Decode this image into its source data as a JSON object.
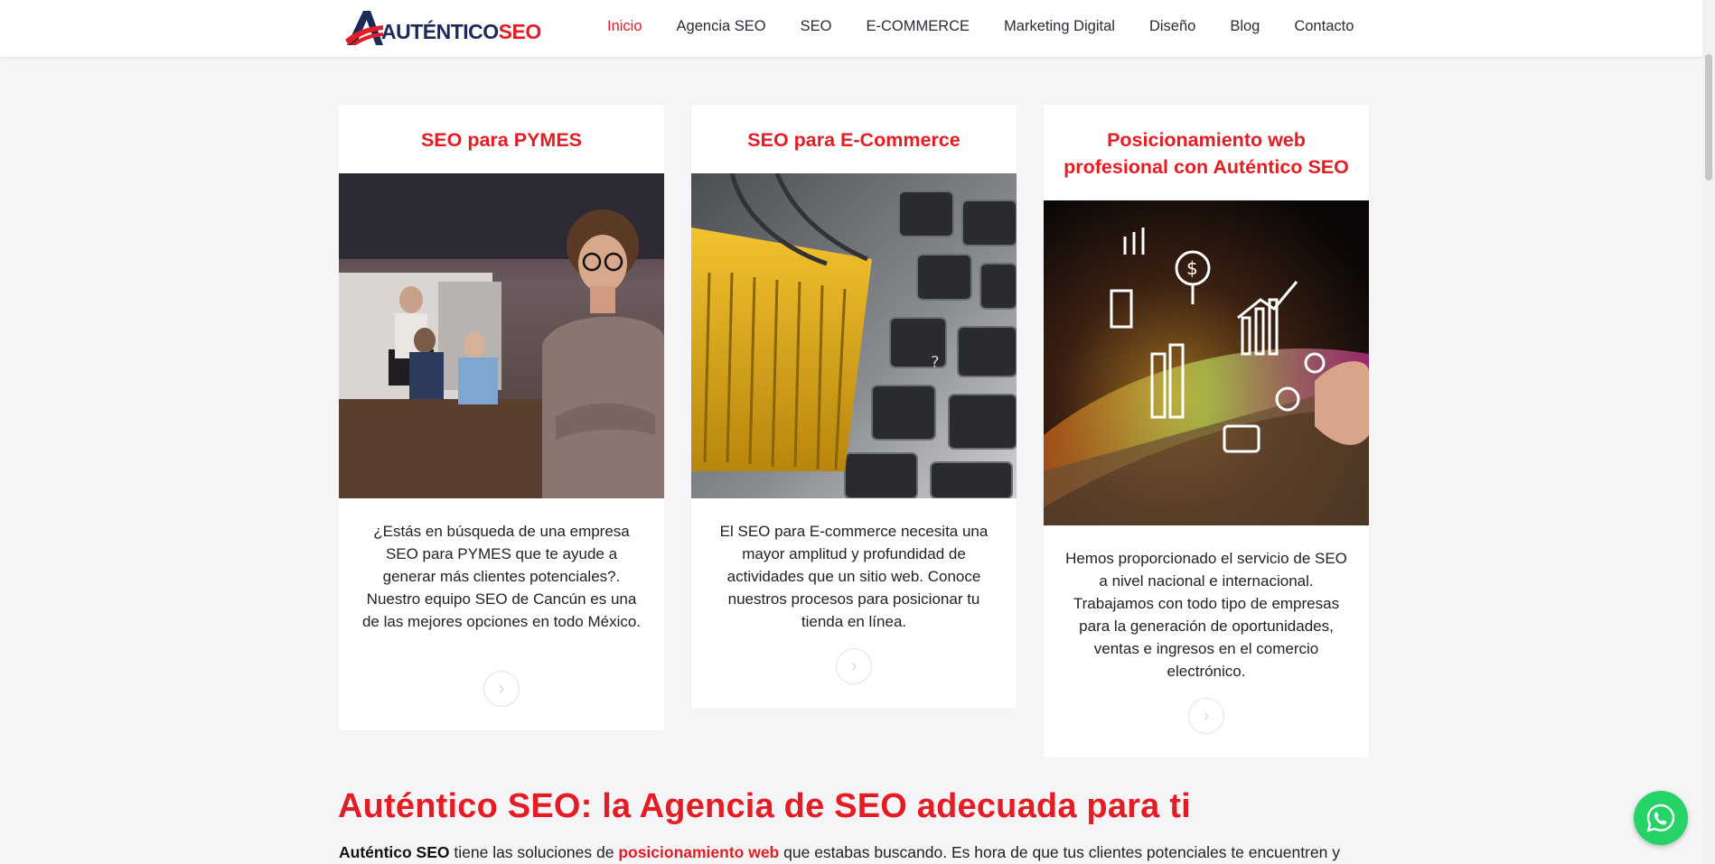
{
  "brand": {
    "logo_part1": "AUTÉNTICO",
    "logo_part2": "SEO",
    "accent_color": "#e41d24",
    "navy_color": "#1d2a57"
  },
  "nav": {
    "items": [
      {
        "label": "Inicio",
        "active": true
      },
      {
        "label": "Agencia SEO",
        "active": false
      },
      {
        "label": "SEO",
        "active": false
      },
      {
        "label": "E-COMMERCE",
        "active": false
      },
      {
        "label": "Marketing Digital",
        "active": false
      },
      {
        "label": "Diseño",
        "active": false
      },
      {
        "label": "Blog",
        "active": false
      },
      {
        "label": "Contacto",
        "active": false
      }
    ]
  },
  "cards": [
    {
      "title": "SEO para PYMES",
      "text": "¿Estás en búsqueda de una empresa SEO para PYMES que te ayude a generar más clientes potenciales?. Nuestro equipo SEO de Cancún es una de las mejores opciones en todo México.",
      "arrow": "›"
    },
    {
      "title": "SEO para E-Commerce",
      "text": "El SEO para E-commerce necesita una mayor amplitud y profundidad de actividades que un sitio web. Conoce nuestros procesos para posicionar tu tienda en línea.",
      "arrow": "›"
    },
    {
      "title": "Posicionamiento web profesional con Auténtico SEO",
      "text": "Hemos proporcionado el servicio de SEO a nivel nacional e internacional. Trabajamos con todo tipo de empresas para la generación de oportunidades, ventas e ingresos en el comercio electrónico.",
      "arrow": "›"
    }
  ],
  "section": {
    "title": "Auténtico SEO: la Agencia de SEO adecuada para ti",
    "intro_strong": "Auténtico SEO",
    "intro_part1": " tiene las soluciones de ",
    "intro_link": "posicionamiento web",
    "intro_part2": " que estabas buscando. Es hora de que tus clientes potenciales te encuentren y"
  },
  "icons": {
    "whatsapp": "whatsapp-icon",
    "arrow": "chevron-right-icon"
  }
}
